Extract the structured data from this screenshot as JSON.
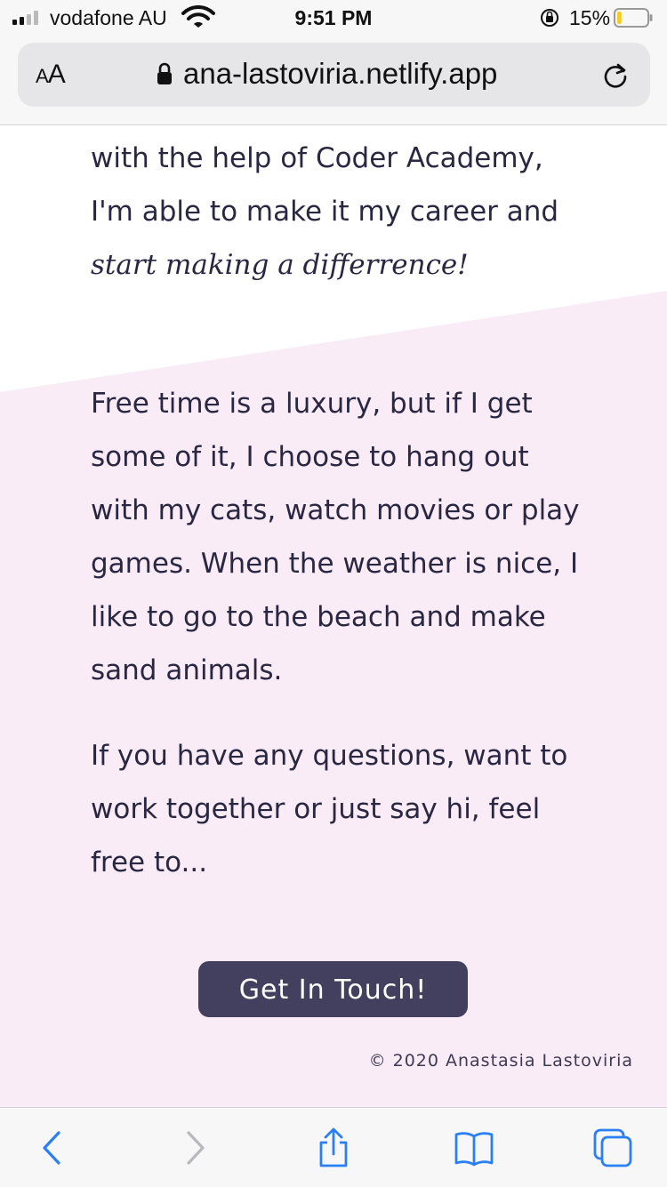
{
  "status_bar": {
    "carrier": "vodafone AU",
    "time": "9:51 PM",
    "battery_percent": "15%",
    "signal_bars": 4,
    "signal_active": 2,
    "battery_level": 0.15,
    "icons": [
      "signal-icon",
      "wifi-icon",
      "rotation-lock-icon",
      "battery-icon"
    ]
  },
  "browser": {
    "text_size_label_small": "A",
    "text_size_label_large": "A",
    "url": "ana-lastoviria.netlify.app",
    "icons": [
      "lock-icon",
      "reload-icon"
    ]
  },
  "page": {
    "paragraph1_plain": "with the help of Coder Academy, I'm able to make it my career and ",
    "paragraph1_emphasis": "start making a differrence!",
    "paragraph2": "Free time is a luxury, but if I get some of it, I choose to hang out with my cats, watch movies or play games. When the weather is nice, I like to go to the beach and make sand animals.",
    "paragraph3": "If you have any questions, want to work together or just say hi, feel free to...",
    "cta_label": "Get In Touch!",
    "copyright": "© 2020 Anastasia Lastoviria"
  },
  "toolbar": {
    "icons": [
      "back-icon",
      "forward-icon",
      "share-icon",
      "bookmarks-icon",
      "tabs-icon"
    ]
  },
  "colors": {
    "text": "#2a2743",
    "pink_background": "#f9ecf6",
    "button": "#43405f",
    "ios_blue": "#2b7ff6",
    "battery_yellow": "#f5cd22"
  }
}
